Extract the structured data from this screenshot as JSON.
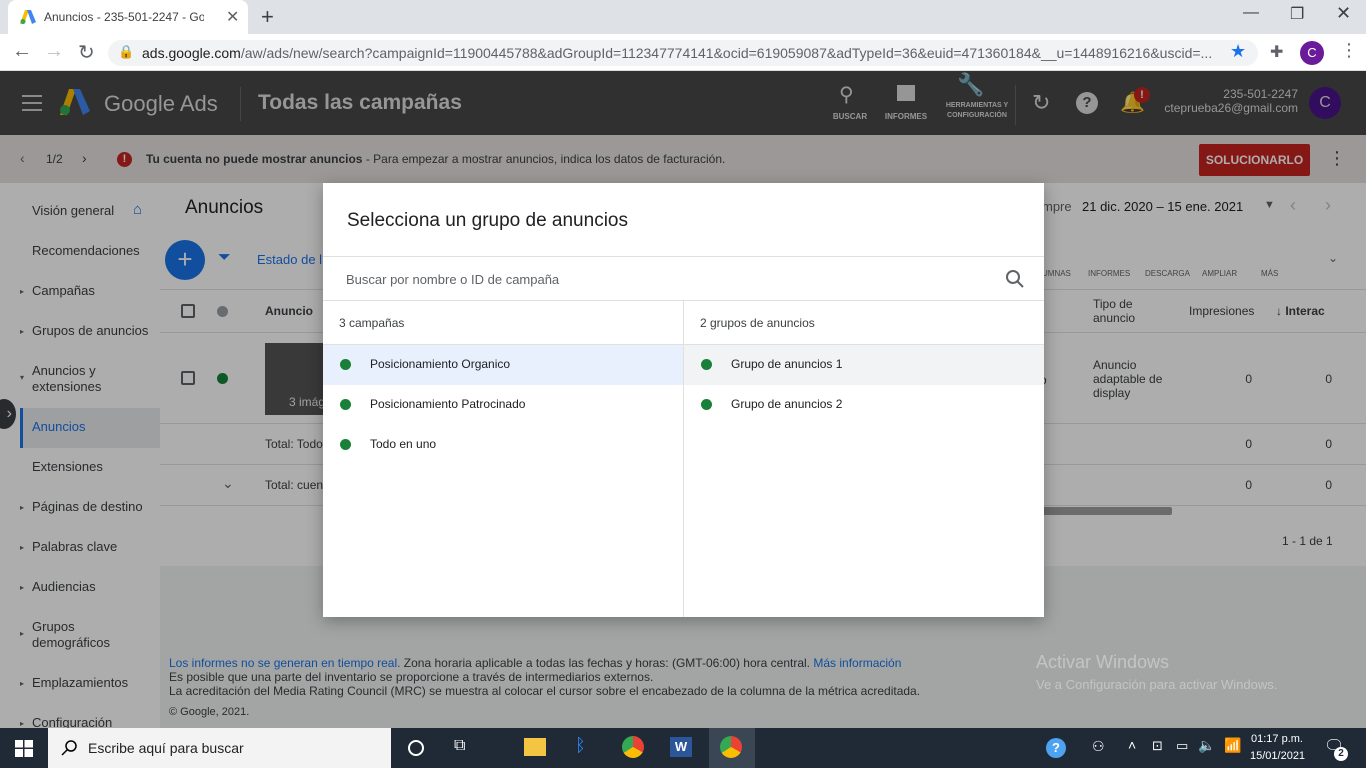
{
  "browser": {
    "tab_title": "Anuncios - 235-501-2247 - Goog",
    "url_host": "ads.google.com",
    "url_path": "/aw/ads/new/search?campaignId=11900445788&adGroupId=112347774141&ocid=619059087&adTypeId=36&euid=471360184&__u=1448916216&uscid=...",
    "profile_initial": "C"
  },
  "header": {
    "product": "Google Ads",
    "section": "Todas las campañas",
    "icons": [
      {
        "name": "search-icon",
        "label": "BUSCAR"
      },
      {
        "name": "reports-icon",
        "label": "INFORMES"
      },
      {
        "name": "tools-icon",
        "label": "HERRAMIENTAS Y CONFIGURACIÓN"
      }
    ],
    "account_id": "235-501-2247",
    "account_email": "ctepruebа26@gmail.com",
    "avatar_initial": "C",
    "notif_badge": "!"
  },
  "notice": {
    "counter": "1/2",
    "bold": "Tu cuenta no puede mostrar anuncios",
    "text": " - Para empezar a mostrar anuncios, indica los datos de facturación.",
    "button": "SOLUCIONARLO"
  },
  "sidebar": {
    "items": [
      {
        "label": "Visión general"
      },
      {
        "label": "Recomendaciones"
      },
      {
        "label": "Campañas"
      },
      {
        "label": "Grupos de anuncios"
      },
      {
        "label": "Anuncios y extensiones"
      },
      {
        "label": "Anuncios"
      },
      {
        "label": "Extensiones"
      },
      {
        "label": "Páginas de destino"
      },
      {
        "label": "Palabras clave"
      },
      {
        "label": "Audiencias"
      },
      {
        "label": "Grupos demográficos"
      },
      {
        "label": "Emplazamientos"
      },
      {
        "label": "Configuración"
      }
    ]
  },
  "page": {
    "title": "Anuncios",
    "filter_label": "Estado de l",
    "date_prefix": "mpre",
    "date_range": "21 dic. 2020 – 15 ene. 2021",
    "toolbar": [
      "UMNAS",
      "INFORMES",
      "DESCARGA",
      "AMPLIAR",
      "MÁS"
    ],
    "columns": {
      "anuncio": "Anuncio",
      "tipo": "Tipo de anuncio",
      "impresiones": "Impresiones",
      "interacciones": "Interac"
    },
    "row": {
      "thumb_text": "3 imág",
      "tipo": "Anuncio adaptable de display",
      "impresiones": "0",
      "interacciones": "0",
      "partial": "o"
    },
    "total1": {
      "label": "Total: Todo",
      "impresiones": "0",
      "interacciones": "0"
    },
    "total2": {
      "label": "Total: cuen",
      "impresiones": "0",
      "interacciones": "0"
    },
    "pagination": "1 - 1 de 1"
  },
  "footer": {
    "line1_link": "Los informes no se generan en tiempo real.",
    "line1_text": " Zona horaria aplicable a todas las fechas y horas: (GMT-06:00) hora central. ",
    "line1_link2": "Más información",
    "line2": "Es posible que una parte del inventario se proporcione a través de intermediarios externos.",
    "line3": "La acreditación del Media Rating Council (MRC) se muestra al colocar el cursor sobre el encabezado de la columna de la métrica acreditada.",
    "copyright": "© Google, 2021."
  },
  "dialog": {
    "title": "Selecciona un grupo de anuncios",
    "search_placeholder": "Buscar por nombre o ID de campaña",
    "campaigns_header": "3 campañas",
    "campaigns": [
      {
        "label": "Posicionamiento Organico"
      },
      {
        "label": "Posicionamiento Patrocinado"
      },
      {
        "label": "Todo en uno"
      }
    ],
    "adgroups_header": "2 grupos de anuncios",
    "adgroups": [
      {
        "label": "Grupo de anuncios 1"
      },
      {
        "label": "Grupo de anuncios 2"
      }
    ]
  },
  "windows": {
    "watermark_title": "Activar Windows",
    "watermark_sub": "Ve a Configuración para activar Windows.",
    "search_placeholder": "Escribe aquí para buscar",
    "time": "01:17 p.m.",
    "date": "15/01/2021",
    "notif_count": "2"
  },
  "colors": {
    "header_bg": "#474849",
    "accent_blue": "#1a73e8",
    "status_green": "#188038",
    "fix_button": "#c5221f"
  }
}
